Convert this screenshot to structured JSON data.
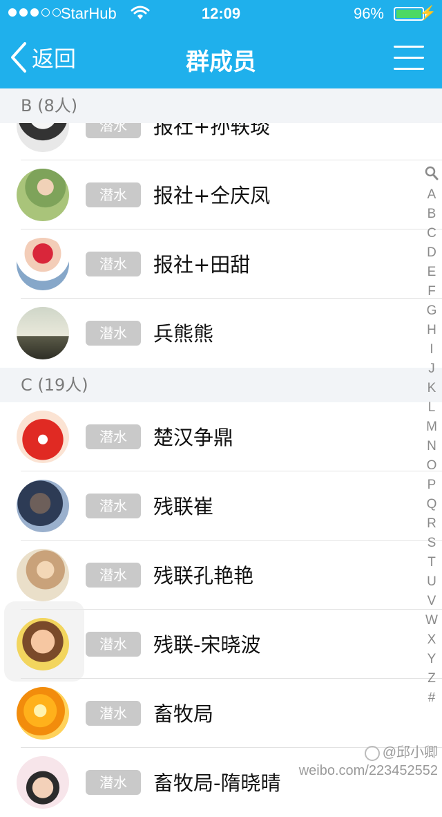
{
  "status_bar": {
    "carrier": "StarHub",
    "time": "12:09",
    "battery": "96%",
    "battery_level": 0.96
  },
  "nav": {
    "back_label": "返回",
    "title": "群成员"
  },
  "role_tag": "潜水",
  "sections": [
    {
      "header": "B (8人)",
      "members": [
        "报社+孙轶琰",
        "报社+仝庆凤",
        "报社+田甜",
        "兵熊熊"
      ]
    },
    {
      "header": "C (19人)",
      "members": [
        "楚汉争鼎",
        "残联崔",
        "残联孔艳艳",
        "残联-宋晓波",
        "畜牧局",
        "畜牧局-隋晓晴"
      ]
    }
  ],
  "index_letters": [
    "A",
    "B",
    "C",
    "D",
    "E",
    "F",
    "G",
    "H",
    "I",
    "J",
    "K",
    "L",
    "M",
    "N",
    "O",
    "P",
    "Q",
    "R",
    "S",
    "T",
    "U",
    "V",
    "W",
    "X",
    "Y",
    "Z",
    "#"
  ],
  "watermark": {
    "handle": "@邱小卿",
    "url": "weibo.com/223452552"
  },
  "colors": {
    "nav_bar": "#1fb0ec",
    "tag_bg": "#c9c9c9",
    "section_bg": "#f2f4f7",
    "battery": "#4cd964"
  }
}
